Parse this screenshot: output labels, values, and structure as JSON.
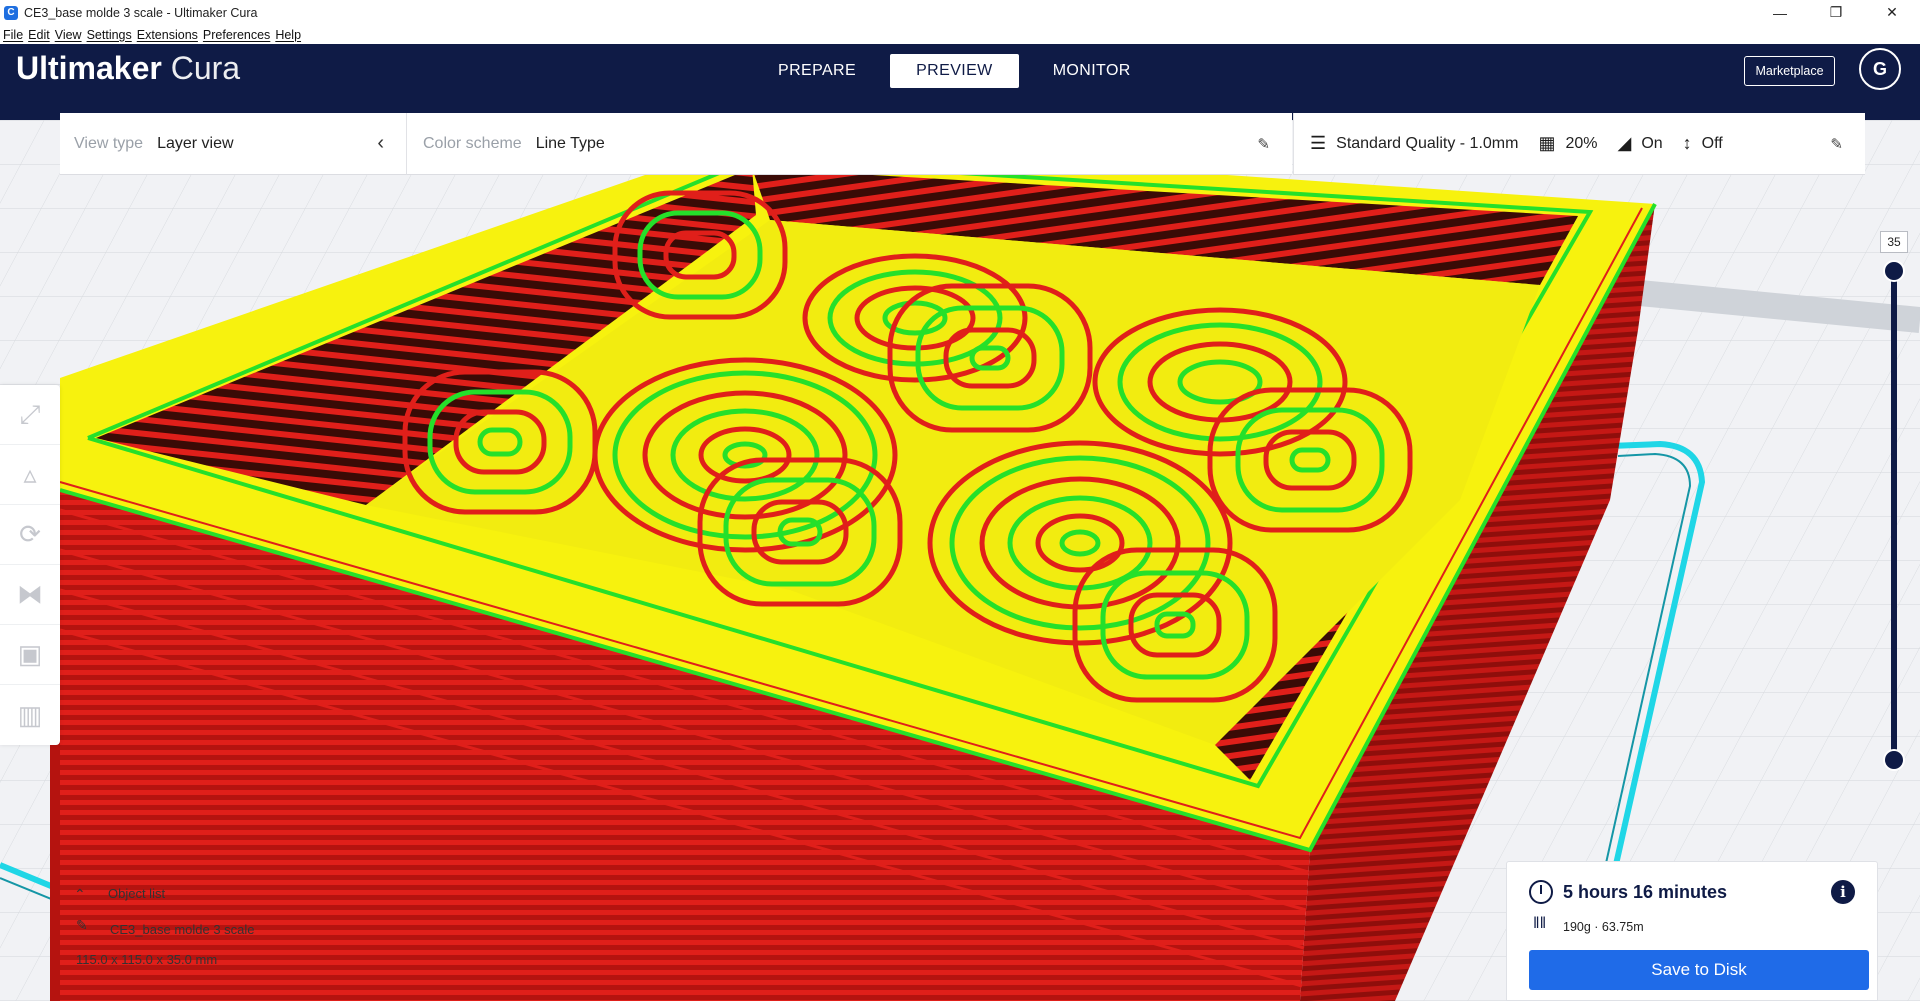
{
  "window": {
    "title": "CE3_base molde 3 scale - Ultimaker Cura",
    "icon_text": "C",
    "controls": [
      "minimize-icon",
      "restore-icon",
      "close-icon"
    ]
  },
  "menu": [
    "File",
    "Edit",
    "View",
    "Settings",
    "Extensions",
    "Preferences",
    "Help"
  ],
  "header": {
    "logo_bold": "Ultimaker",
    "logo_light": "Cura",
    "tabs": [
      {
        "label": "PREPARE",
        "active": false
      },
      {
        "label": "PREVIEW",
        "active": true
      },
      {
        "label": "MONITOR",
        "active": false
      }
    ],
    "marketplace": "Marketplace",
    "avatar_initial": "G"
  },
  "toolbar": {
    "view_type_label": "View type",
    "view_type_value": "Layer view",
    "color_scheme_label": "Color scheme",
    "color_scheme_value": "Line Type",
    "quality": "Standard Quality - 1.0mm",
    "infill": "20%",
    "support": "On",
    "adhesion": "Off"
  },
  "tools": [
    "move-icon",
    "scale-icon",
    "rotate-icon",
    "mirror-icon",
    "per-model-settings-icon",
    "support-blocker-icon"
  ],
  "layer_slider": {
    "current_layer": "35"
  },
  "object_list": {
    "header": "Object list",
    "object_name": "CE3_base molde 3 scale",
    "dimensions": "115.0 x 115.0 x 35.0 mm"
  },
  "print_info": {
    "time": "5 hours 16 minutes",
    "material": "190g · 63.75m",
    "save_label": "Save to Disk"
  },
  "colors": {
    "header_bg": "#0f1b46",
    "wall_outer": "#e01f1a",
    "wall_inner": "#25e02a",
    "skin": "#f7f20e",
    "accent": "#1f6be8",
    "travel": "#1fd6e6"
  }
}
